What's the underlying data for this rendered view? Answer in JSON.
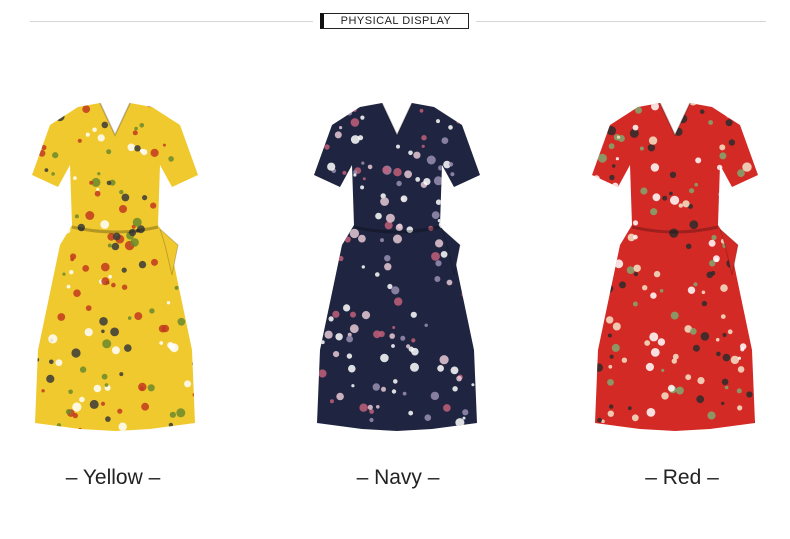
{
  "header": {
    "title": "PHYSICAL DISPLAY"
  },
  "products": [
    {
      "label": "– Yellow –",
      "color": "#f0c92f",
      "print": [
        "#c23a1e",
        "#6a8a2a",
        "#ffffff",
        "#3a3a3a"
      ]
    },
    {
      "label": "– Navy –",
      "color": "#1f2540",
      "print": [
        "#e7c9d6",
        "#ffffff",
        "#9a8fb2",
        "#c25f7a"
      ]
    },
    {
      "label": "– Red –",
      "color": "#d42a26",
      "print": [
        "#f4e3c8",
        "#ffffff",
        "#7fa86e",
        "#2b2b2b"
      ]
    }
  ]
}
